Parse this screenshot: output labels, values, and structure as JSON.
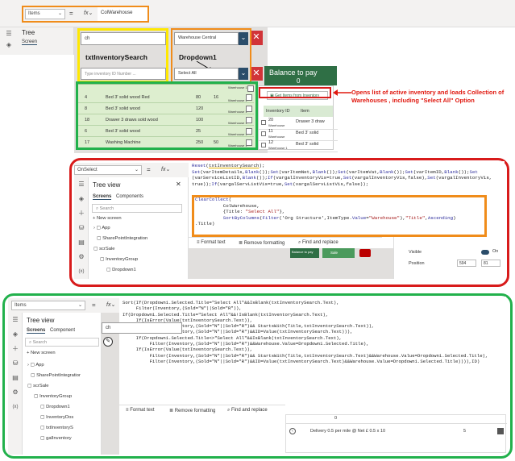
{
  "s1": {
    "property": "Items",
    "fx": "fx",
    "formula": "ColWarehouse",
    "tree_title": "Tree",
    "tab_screens": "Screen",
    "search_value": "ch",
    "dropdown_value": "Warehouse Central",
    "label_search": "txtInventorySearch",
    "label_dropdown": "Dropdown1",
    "search2_placeholder": "Type inventory ID Number ...",
    "dropdown2_value": "Select All",
    "balance_label": "Balance to pay",
    "balance_value": "0",
    "gallery_rows": [
      {
        "id": "4",
        "name": "Bed 3' solid wood Red",
        "a": "80",
        "b": "16",
        "wh": "Warehouse 1"
      },
      {
        "id": "8",
        "name": "Bed 3' solid wood",
        "a": "120",
        "b": "",
        "wh": "Warehouse 1"
      },
      {
        "id": "18",
        "name": "Drawer 3 draws sold wood",
        "a": "100",
        "b": "",
        "wh": "Warehouse 1"
      },
      {
        "id": "6",
        "name": "Bed 3' solid wood",
        "a": "25",
        "b": "",
        "wh": "Warehouse 1"
      },
      {
        "id": "17",
        "name": "Washing Machine",
        "a": "250",
        "b": "50",
        "wh": "Warehouse 1"
      }
    ],
    "gallery_top_wh": "Warehouse 1",
    "get_items_btn": "Get Items from Inventory",
    "inv_head_id": "Inventory ID",
    "inv_head_item": "Item",
    "inv_rows": [
      {
        "id": "20",
        "item": "Drawer 3 draw",
        "wh": "Warehouse"
      },
      {
        "id": "11",
        "item": "Bed 3' solid",
        "wh": "Warehouse"
      },
      {
        "id": "12",
        "item": "Bed 3' solid",
        "wh": "Warehouse 1"
      }
    ],
    "annotation": "Opens list of active inventory and loads Collection of Warehouses , including \"Select All\" Option"
  },
  "s2": {
    "property": "OnSelect",
    "fx": "fx",
    "code_lines": [
      "Reset(txtInventorySearch);",
      "Set(varItemDetails,Blank());Set(varItemNet,Blank());Set(varItemVat,Blank());Set(varItemID,Blank());Set",
      "(varServiceListID,Blank());If(vargalInventoryVis=true,Set(vargalInventoryVis,false),Set(vargalInventoryVis,",
      "true));If(vargalServListVis=true,Set(vargalServListVis,false));"
    ],
    "collect_lines": [
      "ClearCollect(",
      "          ColWarehouse,",
      "          {Title: \"Select All\"},",
      "          SortByColumns(Filter('Org Structure',ItemType.Value=\"Warehouse\"),\"Title\",Ascending)",
      ".Title)"
    ],
    "tree_title": "Tree view",
    "tab_screens": "Screens",
    "tab_components": "Components",
    "search_placeholder": "Search",
    "new_screen": "+ New screen",
    "tree_items": [
      "App",
      "SharePointIntegration",
      "scrSale",
      "InventoryGroup",
      "Dropdown1"
    ],
    "toolbar_format": "Format text",
    "toolbar_remove": "Remove formatting",
    "toolbar_find": "Find and replace",
    "prop_visible": "Visible",
    "prop_on": "On",
    "prop_position": "Position",
    "prop_x": "594",
    "prop_y": "81",
    "mini_balance": "Balance to pay",
    "mini_sale": "Sale"
  },
  "s3": {
    "property": "Items",
    "fx": "fx",
    "code_lines": [
      "Sort(If(Dropdown1.Selected.Title=\"Select All\"&&IsBlank(txtInventorySearch.Text),",
      "     Filter(Inventory,(Sold=\"N\"||Sold=\"R\")),",
      "If(Dropdown1.Selected.Title=\"Select All\"&&!IsBlank(txtInventorySearch.Text),",
      "     If(IsError(Value(txtInventorySearch.Text)),",
      "          Filter(Inventory,(Sold=\"N\"||Sold=\"R\")&& StartsWith(Title,txtInventorySearch.Text)),",
      "          Filter(Inventory,(Sold=\"N\"||Sold=\"R\")&&ID=Value(txtInventorySearch.Text))),",
      "     If(Dropdown1.Selected.Title<>\"Select All\"&&IsBlank(txtInventorySearch.Text),",
      "          Filter(Inventory,(Sold=\"N\"||Sold=\"R\")&&Warehouse.Value=Dropdown1.Selected.Title),",
      "     If(IsError(Value(txtInventorySearch.Text)),",
      "          Filter(Inventory,(Sold=\"N\"||Sold=\"R\")&& StartsWith(Title,txtInventorySearch.Text)&&Warehouse.Value=Dropdown1.Selected.Title),",
      "          Filter(Inventory,(Sold=\"N\"||Sold=\"R\")&&ID=Value(txtInventorySearch.Text)&&Warehouse.Value=Dropdown1.Selected.Title)))),ID)"
    ],
    "tree_title": "Tree view",
    "tab_screens": "Screens",
    "tab_components": "Component",
    "search_placeholder": "Search",
    "new_screen": "+ New screen",
    "tree_items": [
      "App",
      "SharePointIntegratior",
      "scrSale",
      "InventoryGroup",
      "Dropdown1",
      "InventoryDos",
      "txtInventoryS",
      "galInventory"
    ],
    "canvas_search": "ch",
    "toolbar_format": "Format text",
    "toolbar_remove": "Remove formatting",
    "toolbar_find": "Find and replace",
    "row_value": "0",
    "row_text": "Delivery 0.5 per mile @ Net £ 0.5 x 10",
    "row_num": "5"
  }
}
